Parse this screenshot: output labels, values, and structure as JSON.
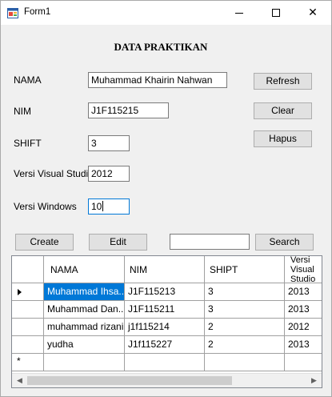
{
  "window": {
    "title": "Form1",
    "minimize_glyph": "",
    "maximize_glyph": "",
    "close_glyph": "✕"
  },
  "form": {
    "heading": "DATA PRAKTIKAN",
    "nama_label": "NAMA",
    "nama_value": "Muhammad Khairin Nahwan",
    "nim_label": "NIM",
    "nim_value": "J1F115215",
    "shift_label": "SHIFT",
    "shift_value": "3",
    "vs_label": "Versi Visual Studio",
    "vs_value": "2012",
    "win_label": "Versi Windows",
    "win_value": "10"
  },
  "buttons": {
    "refresh": "Refresh",
    "clear": "Clear",
    "hapus": "Hapus",
    "create": "Create",
    "edit": "Edit",
    "search": "Search"
  },
  "search": {
    "value": ""
  },
  "grid": {
    "columns": [
      "NAMA",
      "NIM",
      "SHIPT",
      "Versi Visual Studio"
    ],
    "rows": [
      [
        "Muhammad Ihsa...",
        "J1F115213",
        "3",
        "2013"
      ],
      [
        "Muhammad Dan...",
        "J1F115211",
        "3",
        "2013"
      ],
      [
        "muhammad rizani...",
        "j1f115214",
        "2",
        "2012"
      ],
      [
        "yudha",
        "J1f115227",
        "2",
        "2013"
      ]
    ],
    "new_row_marker": "*",
    "scroll_left": "◀",
    "scroll_right": "▶"
  }
}
